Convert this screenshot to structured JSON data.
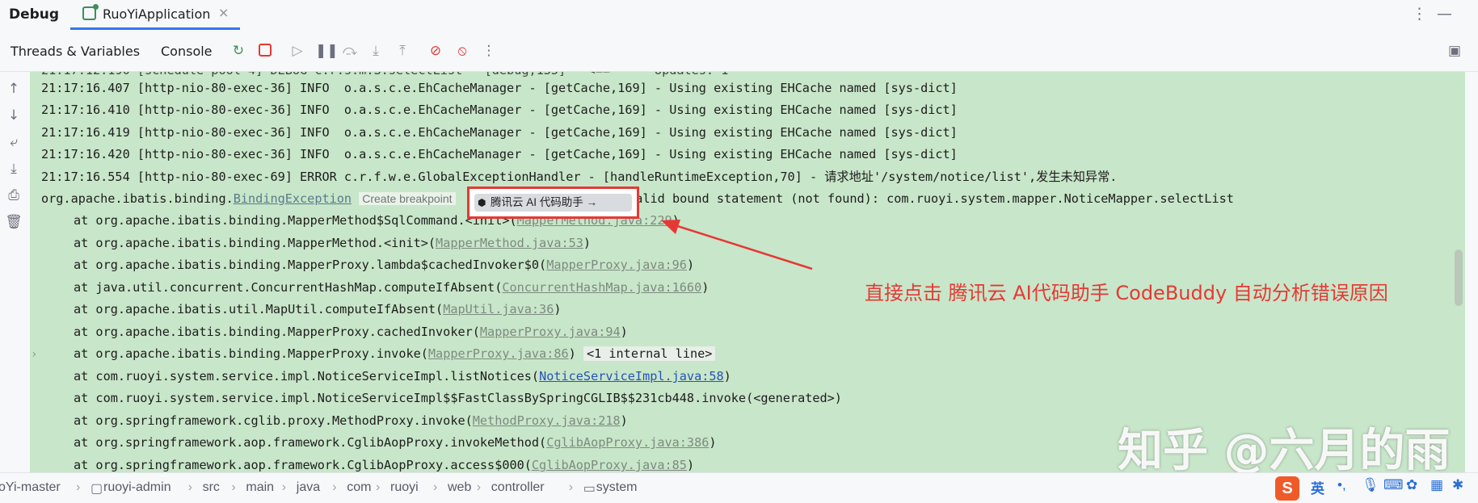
{
  "window": {
    "title": "Debug",
    "tab_label": "RuoYiApplication",
    "tab_close": "×",
    "more_icon": "⋮",
    "minimize_icon": "—"
  },
  "toolbar": {
    "threads_tab": "Threads & Variables",
    "console_tab": "Console"
  },
  "console": {
    "lines": [
      {
        "text": "21:17:16.407 [http-nio-80-exec-36] INFO  o.a.s.c.e.EhCacheManager - [getCache,169] - Using existing EHCache named [sys-dict]"
      },
      {
        "text": "21:17:16.410 [http-nio-80-exec-36] INFO  o.a.s.c.e.EhCacheManager - [getCache,169] - Using existing EHCache named [sys-dict]"
      },
      {
        "text": "21:17:16.419 [http-nio-80-exec-36] INFO  o.a.s.c.e.EhCacheManager - [getCache,169] - Using existing EHCache named [sys-dict]"
      },
      {
        "text": "21:17:16.420 [http-nio-80-exec-36] INFO  o.a.s.c.e.EhCacheManager - [getCache,169] - Using existing EHCache named [sys-dict]"
      },
      {
        "text": "21:17:16.554 [http-nio-80-exec-69] ERROR c.r.f.w.e.GlobalExceptionHandler - [handleRuntimeException,70] - 请求地址'/system/notice/list',发生未知异常."
      }
    ],
    "exception": {
      "prefix": "org.apache.ibatis.binding.",
      "link": "BindingException",
      "hint": "Create breakpoint",
      "message": ": Invalid bound statement (not found): com.ruoyi.system.mapper.NoticeMapper.selectList"
    },
    "ai_button": "腾讯云 AI 代码助手 →",
    "stack": [
      {
        "pre": "at org.apache.ibatis.binding.MapperMethod$SqlCommand.<init>(",
        "link": "MapperMethod.java:229",
        "post": ")",
        "blue": false
      },
      {
        "pre": "at org.apache.ibatis.binding.MapperMethod.<init>(",
        "link": "MapperMethod.java:53",
        "post": ")",
        "blue": false
      },
      {
        "pre": "at org.apache.ibatis.binding.MapperProxy.lambda$cachedInvoker$0(",
        "link": "MapperProxy.java:96",
        "post": ")",
        "blue": false
      },
      {
        "pre": "at java.util.concurrent.ConcurrentHashMap.computeIfAbsent(",
        "link": "ConcurrentHashMap.java:1660",
        "post": ")",
        "blue": false
      },
      {
        "pre": "at org.apache.ibatis.util.MapUtil.computeIfAbsent(",
        "link": "MapUtil.java:36",
        "post": ")",
        "blue": false
      },
      {
        "pre": "at org.apache.ibatis.binding.MapperProxy.cachedInvoker(",
        "link": "MapperProxy.java:94",
        "post": ")",
        "blue": false
      },
      {
        "pre": "at org.apache.ibatis.binding.MapperProxy.invoke(",
        "link": "MapperProxy.java:86",
        "post": ")",
        "internal": "<1 internal line>",
        "blue": false
      },
      {
        "pre": "at com.ruoyi.system.service.impl.NoticeServiceImpl.listNotices(",
        "link": "NoticeServiceImpl.java:58",
        "post": ")",
        "blue": true
      },
      {
        "pre": "at com.ruoyi.system.service.impl.NoticeServiceImpl$$FastClassBySpringCGLIB$$231cb448.invoke(<generated>)",
        "link": "",
        "post": "",
        "blue": false
      },
      {
        "pre": "at org.springframework.cglib.proxy.MethodProxy.invoke(",
        "link": "MethodProxy.java:218",
        "post": ")",
        "blue": false
      },
      {
        "pre": "at org.springframework.aop.framework.CglibAopProxy.invokeMethod(",
        "link": "CglibAopProxy.java:386",
        "post": ")",
        "blue": false
      },
      {
        "pre": "at org.springframework.aop.framework.CglibAopProxy.access$000(",
        "link": "CglibAopProxy.java:85",
        "post": ")",
        "blue": false
      }
    ]
  },
  "annotation": "直接点击 腾讯云 AI代码助手 CodeBuddy 自动分析错误原因",
  "watermark": "知乎 @六月的雨",
  "breadcrumbs": [
    "oYi-master",
    "ruoyi-admin",
    "src",
    "main",
    "java",
    "com",
    "ruoyi",
    "web",
    "controller",
    "system"
  ],
  "ime": {
    "logo": "S",
    "lang": "英"
  },
  "colors": {
    "accent": "#3574f0",
    "console_bg": "#c8e6c9",
    "annotation": "#e53935"
  }
}
